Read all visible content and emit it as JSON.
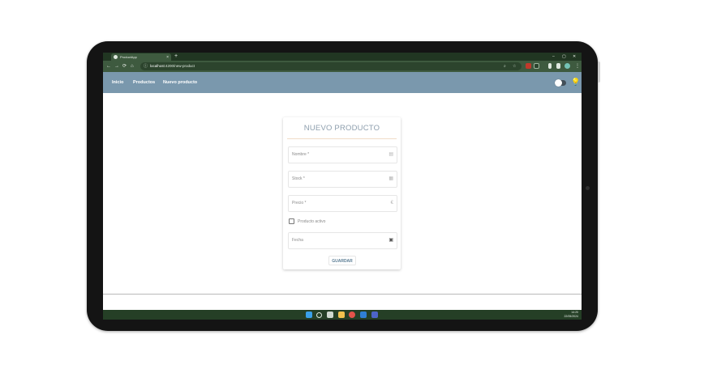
{
  "browser": {
    "tab_title": "ProductApp",
    "tab_close": "×",
    "new_tab": "+",
    "window_controls": {
      "minimize": "–",
      "maximize": "▢",
      "close": "✕"
    },
    "nav": {
      "back": "←",
      "forward": "→",
      "reload": "⟳",
      "home": "⌂"
    },
    "url_host": "localhost",
    "url_path": ":4200/new-product",
    "icons": [
      "zoom-icon",
      "star-icon",
      "extensions-icon",
      "profile-icon",
      "menu-icon"
    ]
  },
  "app": {
    "nav_links": [
      "Inicio",
      "Productos",
      "Nuevo producto"
    ]
  },
  "form": {
    "title": "NUEVO PRODUCTO",
    "fields": {
      "name": {
        "placeholder": "Nombre *",
        "value": ""
      },
      "stock": {
        "placeholder": "Stock *",
        "value": ""
      },
      "price": {
        "placeholder": "Precio *",
        "value": ""
      },
      "date": {
        "placeholder": "Fecha",
        "value": ""
      }
    },
    "active_label": "Producto activo",
    "active_checked": false,
    "save_label": "GUARDAR"
  },
  "taskbar": {
    "time": "14:20",
    "date": "22/05/2024"
  },
  "colors": {
    "browser_chrome": "#3e5a3f",
    "tabbar": "#213622",
    "app_header": "#7a98ad",
    "card_title": "#8d9ead",
    "save_button_text": "#5b7d94",
    "taskbar": "#253f26"
  }
}
